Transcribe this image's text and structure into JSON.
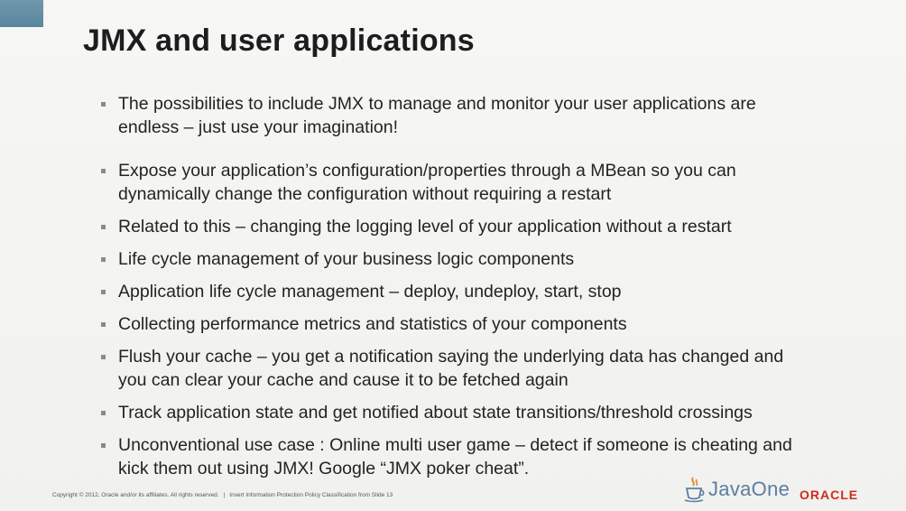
{
  "slide": {
    "title": "JMX and user applications",
    "bullets": [
      {
        "lines": [
          "The possibilities to include JMX to manage and monitor your user applications are",
          "endless – just use your imagination!"
        ]
      },
      {
        "lines": [
          "Expose your application’s configuration/properties through a MBean so you can",
          "dynamically change the configuration without requiring a restart"
        ]
      },
      {
        "lines": [
          "Related to this – changing the logging level of your application without a restart"
        ]
      },
      {
        "lines": [
          "Life cycle management of your business logic components"
        ]
      },
      {
        "lines": [
          "Application life cycle management – deploy, undeploy, start, stop"
        ]
      },
      {
        "lines": [
          "Collecting performance metrics and statistics of your components"
        ]
      },
      {
        "lines": [
          "Flush your cache – you get a notification saying the underlying data has changed and",
          "you can clear your cache and cause it to be fetched again"
        ]
      },
      {
        "lines": [
          "Track application state and get notified about state transitions/threshold crossings"
        ]
      },
      {
        "lines": [
          "Unconventional use case : Online multi user game – detect if someone is cheating and",
          "kick them out using JMX! Google “JMX poker cheat”."
        ]
      }
    ]
  },
  "footer": {
    "copyright": "Copyright © 2012, Oracle and/or its affiliates. All rights reserved.",
    "separator": "|",
    "policy": "Insert Information Protection Policy Classification from Slide 13",
    "javaone_label": "JavaOne",
    "oracle_label": "ORACLE"
  },
  "colors": {
    "accent": "#5b86a0",
    "oracle_red": "#d22a1e",
    "javaone_blue": "#5c7da0"
  }
}
